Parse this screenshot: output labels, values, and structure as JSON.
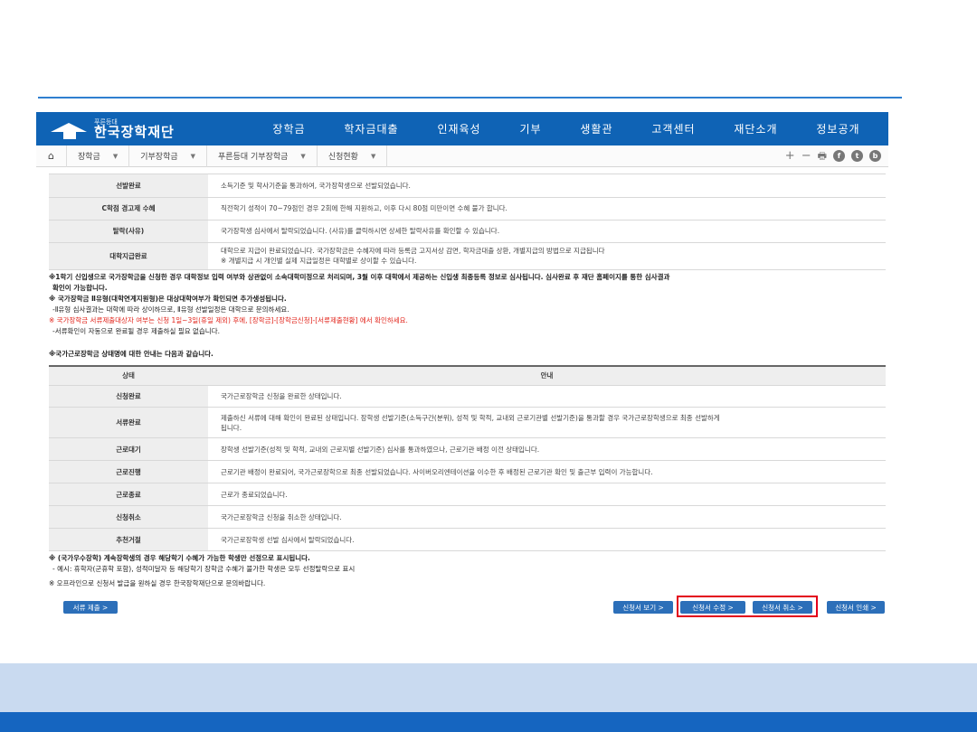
{
  "header": {
    "logo_sub": "푸른등대",
    "logo_main": "한국장학재단",
    "menu": [
      "장학금",
      "학자금대출",
      "인재육성",
      "기부",
      "생활관",
      "고객센터",
      "재단소개",
      "정보공개"
    ]
  },
  "subnav": {
    "home_icon": "home-icon",
    "crumbs": [
      "장학금",
      "기부장학금",
      "푸른등대 기부장학금",
      "신청현황"
    ],
    "tools": [
      "+",
      "−",
      "🖶",
      "f",
      "t",
      "b"
    ]
  },
  "status_table_1": {
    "rows": [
      {
        "key": "선발완료",
        "value": "소득기준 및 학사기준을 통과하여, 국가장학생으로 선발되었습니다."
      },
      {
        "key": "C학점 경고제 수혜",
        "value": "직전학기 성적이 70~79점인 경우 2회에 한해 지원하고, 이후 다시 80점 미만이면 수혜 불가 합니다."
      },
      {
        "key": "탈락(사유)",
        "value": "국가장학생 심사에서 탈락되었습니다. (사유)를 클릭하시면 상세한 탈락사유를 확인할 수 있습니다."
      },
      {
        "key": "대학지급완료",
        "value": "대학으로 지급이 완료되었습니다. 국가장학금은 수혜자에 따라 등록금 고지서상 감면, 학자금대출 상환, 개별지급의 방법으로 지급됩니다",
        "value2": "※ 개별지급 시 개인별 실제 지급일정은 대학별로 상이할 수 있습니다."
      }
    ]
  },
  "notes_1": [
    "※1학기 신입생으로 국가장학금을 신청한 경우 대학정보 입력 여부와 상관없이 소속대학미정으로 처리되며, 3월 이후 대학에서 제공하는 신입생 최종등록 정보로 심사됩니다. 심사완료 후 재단 홈페이지를 통한 심사결과",
    "확인이 가능합니다.",
    "※ 국가장학금 Ⅱ유형(대학연계지원형)은 대상대학여부가 확인되면 추가생성됩니다.",
    "-Ⅱ유형 심사결과는 대학에 따라 상이하므로, Ⅱ유형 선발일정은 대학으로 문의하세요.",
    "※ 국가장학금 서류제출대상자 여부는 신청 1일~3일(휴일 제외) 후에, [장학금]-[장학금신청]-[서류제출현황] 에서 확인하세요.",
    "-서류확인이 자동으로 완료될 경우 제출하실 필요 없습니다."
  ],
  "section_title": "※국가근로장학금 상태명에 대한 안내는 다음과 같습니다.",
  "status_table_2": {
    "headers": [
      "상태",
      "안내"
    ],
    "rows": [
      {
        "key": "신청완료",
        "value": "국가근로장학금 신청을 완료한 상태입니다."
      },
      {
        "key": "서류완료",
        "value": "제출하신 서류에 대해 확인이 완료된 상태입니다. 장학생 선발기준(소득구간(분위), 성적 및 학적, 교내외 근로기관별 선발기준)을 통과할 경우 국가근로장학생으로 최종 선발하게",
        "value2": "됩니다."
      },
      {
        "key": "근로대기",
        "value": "장학생 선발기준(성적 및 학적, 교내외 근로지별 선발기준) 심사를 통과하였으나, 근로기관 배정 이전 상태입니다."
      },
      {
        "key": "근로진행",
        "value": "근로기관 배정이 완료되어, 국가근로장학으로 최종 선발되었습니다. 사이버오리엔테이션을 이수한 후 배정된 근로기관 확인 및 출근부 입력이 가능합니다."
      },
      {
        "key": "근로종료",
        "value": "근로가 종료되었습니다."
      },
      {
        "key": "신청취소",
        "value": "국가근로장학금 신청을 취소한 상태입니다."
      },
      {
        "key": "추천거절",
        "value": "국가근로장학생 선발 심사에서 탈락되었습니다."
      }
    ]
  },
  "notes_2": [
    "※ (국가우수장학) 계속장학생의 경우 해당학기 수혜가 가능한 학생만 선정으로 표시됩니다.",
    "- 예시: 휴학자(군휴학 포함), 성적미달자 등 해당학기 장학금 수혜가 불가한 학생은 모두 선정탈락으로 표시",
    "※ 오프라인으로 신청서 발급을 원하실 경우 한국장학재단으로 문의바랍니다."
  ],
  "buttons": {
    "submit_docs": "서류 제출 >",
    "view": "신청서 보기 >",
    "edit": "신청서 수정 >",
    "cancel": "신청서 취소 >",
    "print": "신청서 인쇄 >"
  },
  "colors": {
    "brand_blue": "#0f63b5",
    "button_blue": "#2c6fb9",
    "highlight_red": "#e3001b",
    "footer_light": "#c9daf0",
    "footer_dark": "#1565c0"
  }
}
